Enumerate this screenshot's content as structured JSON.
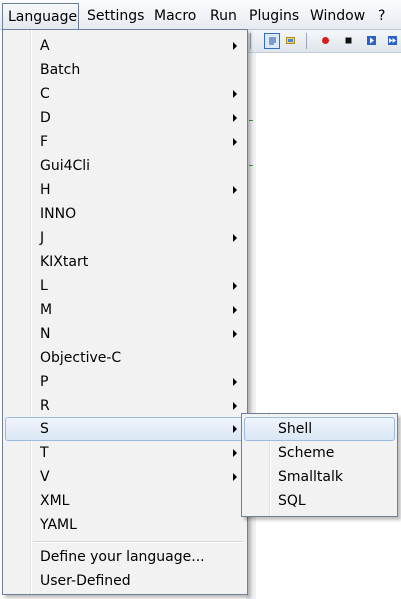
{
  "menubar": {
    "items": [
      "Language",
      "Settings",
      "Macro",
      "Run",
      "Plugins",
      "Window",
      "?"
    ],
    "close_glyph": "×"
  },
  "language_menu": {
    "items": [
      {
        "label": "A",
        "submenu": true
      },
      {
        "label": "Batch",
        "submenu": false
      },
      {
        "label": "C",
        "submenu": true
      },
      {
        "label": "D",
        "submenu": true
      },
      {
        "label": "F",
        "submenu": true
      },
      {
        "label": "Gui4Cli",
        "submenu": false
      },
      {
        "label": "H",
        "submenu": true
      },
      {
        "label": "INNO",
        "submenu": false
      },
      {
        "label": "J",
        "submenu": true
      },
      {
        "label": "KIXtart",
        "submenu": false
      },
      {
        "label": "L",
        "submenu": true
      },
      {
        "label": "M",
        "submenu": true
      },
      {
        "label": "N",
        "submenu": true
      },
      {
        "label": "Objective-C",
        "submenu": false
      },
      {
        "label": "P",
        "submenu": true
      },
      {
        "label": "R",
        "submenu": true
      },
      {
        "label": "S",
        "submenu": true,
        "highlighted": true
      },
      {
        "label": "T",
        "submenu": true
      },
      {
        "label": "V",
        "submenu": true
      },
      {
        "label": "XML",
        "submenu": false
      },
      {
        "label": "YAML",
        "submenu": false
      }
    ],
    "footer": [
      "Define your language...",
      "User-Defined"
    ]
  },
  "s_submenu": {
    "items": [
      {
        "label": "Shell",
        "highlighted": true
      },
      {
        "label": "Scheme"
      },
      {
        "label": "Smalltalk"
      },
      {
        "label": "SQL"
      }
    ]
  },
  "toolbar": {
    "icons": [
      "word-wrap-icon",
      "document-map-icon",
      "record-macro-icon",
      "stop-macro-icon",
      "play-macro-icon",
      "run-multiple-macro-icon"
    ]
  },
  "colors": {
    "accent_border": "#6d7f99",
    "hover_fill": "#dbe7f6",
    "hover_border": "#9cb9de",
    "record_red": "#d81e1e",
    "play_blue": "#2a63c5"
  }
}
